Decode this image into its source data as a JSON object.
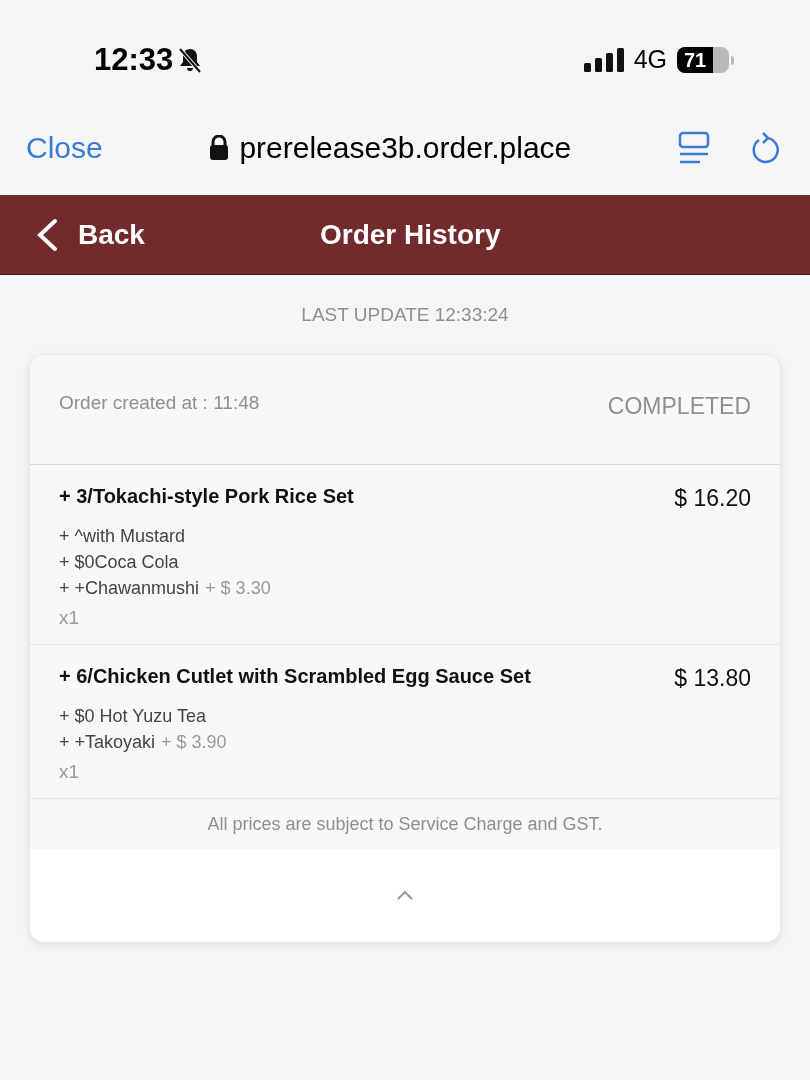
{
  "status_bar": {
    "time": "12:33",
    "network": "4G",
    "battery": "71"
  },
  "browser": {
    "close": "Close",
    "url": "prerelease3b.order.place"
  },
  "header": {
    "back": "Back",
    "title": "Order History"
  },
  "last_update": "LAST UPDATE 12:33:24",
  "order": {
    "created": "Order created at : 11:48",
    "status": "COMPLETED",
    "items": [
      {
        "name": "+ 3/Tokachi-style Pork Rice Set",
        "price": "$ 16.20",
        "addons": [
          {
            "text": "+ ^with Mustard"
          },
          {
            "text": "+ $0Coca Cola"
          },
          {
            "text": "+ +Chawanmushi",
            "price": "+ $ 3.30"
          }
        ],
        "quantity": "x1"
      },
      {
        "name": "+ 6/Chicken Cutlet with Scrambled Egg Sauce Set",
        "price": "$ 13.80",
        "addons": [
          {
            "text": "+ $0 Hot Yuzu Tea"
          },
          {
            "text": "+ +Takoyaki",
            "price": "+ $ 3.90"
          }
        ],
        "quantity": "x1"
      }
    ],
    "note": "All prices are subject to Service Charge and GST."
  }
}
